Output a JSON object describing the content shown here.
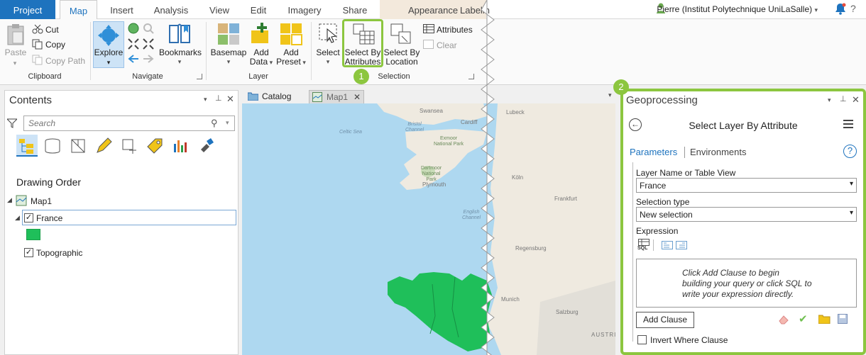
{
  "tabs": {
    "project": "Project",
    "map": "Map",
    "insert": "Insert",
    "analysis": "Analysis",
    "view": "View",
    "edit": "Edit",
    "imagery": "Imagery",
    "share": "Share",
    "appearance": "Appearance",
    "labeling": "Labelin"
  },
  "user": "Pierre (Institut Polytechnique UniLaSalle)",
  "ribbon": {
    "clipboard": {
      "paste": "Paste",
      "cut": "Cut",
      "copy": "Copy",
      "copy_path": "Copy Path",
      "group": "Clipboard"
    },
    "navigate": {
      "explore": "Explore",
      "bookmarks": "Bookmarks",
      "group": "Navigate"
    },
    "layer": {
      "basemap": "Basemap",
      "add_data_1": "Add",
      "add_data_2": "Data",
      "add_preset_1": "Add",
      "add_preset_2": "Preset",
      "group": "Layer"
    },
    "selection": {
      "select": "Select",
      "sba_1": "Select By",
      "sba_2": "Attributes",
      "sbl_1": "Select By",
      "sbl_2": "Location",
      "attributes": "Attributes",
      "clear": "Clear",
      "group": "Selection"
    }
  },
  "badges": {
    "one": "1",
    "two": "2"
  },
  "contents": {
    "title": "Contents",
    "search_placeholder": "Search",
    "drawing_order": "Drawing Order",
    "map": "Map1",
    "layers": [
      {
        "name": "France",
        "checked": true
      },
      {
        "name": "Topographic",
        "checked": true
      }
    ]
  },
  "mapview": {
    "catalog": "Catalog",
    "map1": "Map1"
  },
  "map_labels": {
    "swansea": "Swansea",
    "cardiff": "Cardiff",
    "celtic_sea": "Celtic Sea",
    "bristol_1": "Bristol",
    "bristol_2": "Channel",
    "exmoor_1": "Exmoor",
    "exmoor_2": "National Park",
    "dartmoor_1": "Dartmoor",
    "dartmoor_2": "National",
    "dartmoor_3": "Park",
    "plymouth": "Plymouth",
    "english_1": "English",
    "english_2": "Channel",
    "regensburg": "Regensburg",
    "munich": "Munich",
    "salzburg": "Salzburg",
    "austria": "AUSTRI",
    "koln": "Köln",
    "frankfurt": "Frankfurt",
    "lubeck": "Lubeck",
    "sql": "SQL"
  },
  "geo": {
    "title": "Geoprocessing",
    "tool": "Select Layer By Attribute",
    "tab_params": "Parameters",
    "tab_env": "Environments",
    "help": "?",
    "layer_label": "Layer Name or Table View",
    "layer_value": "France",
    "seltype_label": "Selection type",
    "seltype_value": "New selection",
    "expression_label": "Expression",
    "hint_1": "Click Add Clause to begin",
    "hint_2": "building your query or click SQL to",
    "hint_3": "write your expression directly.",
    "add_clause": "Add Clause",
    "invert": "Invert Where Clause"
  },
  "colors": {
    "accent": "#1e73be",
    "highlight": "#8cc63f",
    "france": "#1fbf5a",
    "sea": "#aed8f0"
  }
}
